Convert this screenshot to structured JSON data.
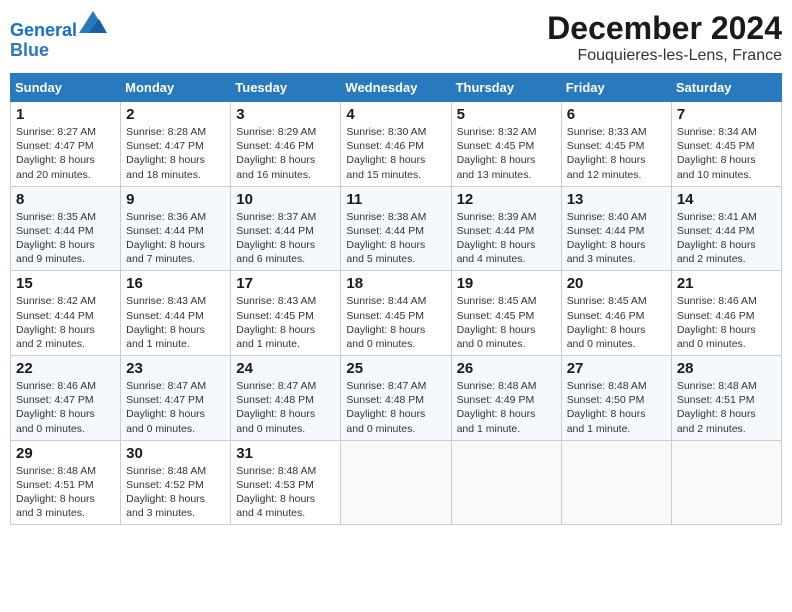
{
  "logo": {
    "line1": "General",
    "line2": "Blue"
  },
  "title": "December 2024",
  "subtitle": "Fouquieres-les-Lens, France",
  "days_header": [
    "Sunday",
    "Monday",
    "Tuesday",
    "Wednesday",
    "Thursday",
    "Friday",
    "Saturday"
  ],
  "weeks": [
    [
      {
        "day": "1",
        "info": "Sunrise: 8:27 AM\nSunset: 4:47 PM\nDaylight: 8 hours\nand 20 minutes."
      },
      {
        "day": "2",
        "info": "Sunrise: 8:28 AM\nSunset: 4:47 PM\nDaylight: 8 hours\nand 18 minutes."
      },
      {
        "day": "3",
        "info": "Sunrise: 8:29 AM\nSunset: 4:46 PM\nDaylight: 8 hours\nand 16 minutes."
      },
      {
        "day": "4",
        "info": "Sunrise: 8:30 AM\nSunset: 4:46 PM\nDaylight: 8 hours\nand 15 minutes."
      },
      {
        "day": "5",
        "info": "Sunrise: 8:32 AM\nSunset: 4:45 PM\nDaylight: 8 hours\nand 13 minutes."
      },
      {
        "day": "6",
        "info": "Sunrise: 8:33 AM\nSunset: 4:45 PM\nDaylight: 8 hours\nand 12 minutes."
      },
      {
        "day": "7",
        "info": "Sunrise: 8:34 AM\nSunset: 4:45 PM\nDaylight: 8 hours\nand 10 minutes."
      }
    ],
    [
      {
        "day": "8",
        "info": "Sunrise: 8:35 AM\nSunset: 4:44 PM\nDaylight: 8 hours\nand 9 minutes."
      },
      {
        "day": "9",
        "info": "Sunrise: 8:36 AM\nSunset: 4:44 PM\nDaylight: 8 hours\nand 7 minutes."
      },
      {
        "day": "10",
        "info": "Sunrise: 8:37 AM\nSunset: 4:44 PM\nDaylight: 8 hours\nand 6 minutes."
      },
      {
        "day": "11",
        "info": "Sunrise: 8:38 AM\nSunset: 4:44 PM\nDaylight: 8 hours\nand 5 minutes."
      },
      {
        "day": "12",
        "info": "Sunrise: 8:39 AM\nSunset: 4:44 PM\nDaylight: 8 hours\nand 4 minutes."
      },
      {
        "day": "13",
        "info": "Sunrise: 8:40 AM\nSunset: 4:44 PM\nDaylight: 8 hours\nand 3 minutes."
      },
      {
        "day": "14",
        "info": "Sunrise: 8:41 AM\nSunset: 4:44 PM\nDaylight: 8 hours\nand 2 minutes."
      }
    ],
    [
      {
        "day": "15",
        "info": "Sunrise: 8:42 AM\nSunset: 4:44 PM\nDaylight: 8 hours\nand 2 minutes."
      },
      {
        "day": "16",
        "info": "Sunrise: 8:43 AM\nSunset: 4:44 PM\nDaylight: 8 hours\nand 1 minute."
      },
      {
        "day": "17",
        "info": "Sunrise: 8:43 AM\nSunset: 4:45 PM\nDaylight: 8 hours\nand 1 minute."
      },
      {
        "day": "18",
        "info": "Sunrise: 8:44 AM\nSunset: 4:45 PM\nDaylight: 8 hours\nand 0 minutes."
      },
      {
        "day": "19",
        "info": "Sunrise: 8:45 AM\nSunset: 4:45 PM\nDaylight: 8 hours\nand 0 minutes."
      },
      {
        "day": "20",
        "info": "Sunrise: 8:45 AM\nSunset: 4:46 PM\nDaylight: 8 hours\nand 0 minutes."
      },
      {
        "day": "21",
        "info": "Sunrise: 8:46 AM\nSunset: 4:46 PM\nDaylight: 8 hours\nand 0 minutes."
      }
    ],
    [
      {
        "day": "22",
        "info": "Sunrise: 8:46 AM\nSunset: 4:47 PM\nDaylight: 8 hours\nand 0 minutes."
      },
      {
        "day": "23",
        "info": "Sunrise: 8:47 AM\nSunset: 4:47 PM\nDaylight: 8 hours\nand 0 minutes."
      },
      {
        "day": "24",
        "info": "Sunrise: 8:47 AM\nSunset: 4:48 PM\nDaylight: 8 hours\nand 0 minutes."
      },
      {
        "day": "25",
        "info": "Sunrise: 8:47 AM\nSunset: 4:48 PM\nDaylight: 8 hours\nand 0 minutes."
      },
      {
        "day": "26",
        "info": "Sunrise: 8:48 AM\nSunset: 4:49 PM\nDaylight: 8 hours\nand 1 minute."
      },
      {
        "day": "27",
        "info": "Sunrise: 8:48 AM\nSunset: 4:50 PM\nDaylight: 8 hours\nand 1 minute."
      },
      {
        "day": "28",
        "info": "Sunrise: 8:48 AM\nSunset: 4:51 PM\nDaylight: 8 hours\nand 2 minutes."
      }
    ],
    [
      {
        "day": "29",
        "info": "Sunrise: 8:48 AM\nSunset: 4:51 PM\nDaylight: 8 hours\nand 3 minutes."
      },
      {
        "day": "30",
        "info": "Sunrise: 8:48 AM\nSunset: 4:52 PM\nDaylight: 8 hours\nand 3 minutes."
      },
      {
        "day": "31",
        "info": "Sunrise: 8:48 AM\nSunset: 4:53 PM\nDaylight: 8 hours\nand 4 minutes."
      },
      null,
      null,
      null,
      null
    ]
  ]
}
